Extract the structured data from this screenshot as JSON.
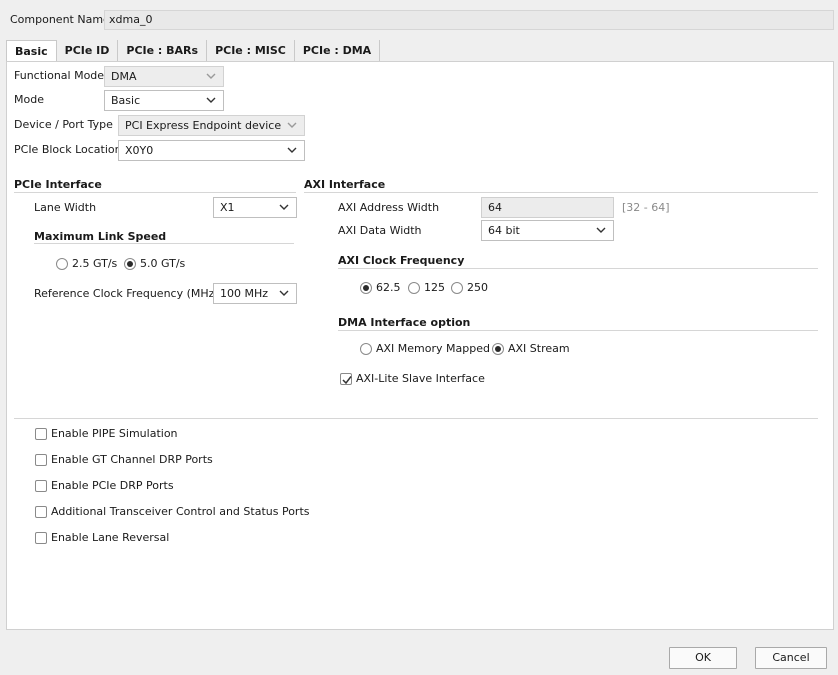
{
  "component": {
    "label": "Component Name",
    "value": "xdma_0"
  },
  "tabs": [
    "Basic",
    "PCIe ID",
    "PCIe : BARs",
    "PCIe : MISC",
    "PCIe : DMA"
  ],
  "basic": {
    "functional_mode": {
      "label": "Functional Mode",
      "value": "DMA"
    },
    "mode": {
      "label": "Mode",
      "value": "Basic"
    },
    "device_port_type": {
      "label": "Device / Port Type",
      "value": "PCI Express Endpoint device"
    },
    "block_location": {
      "label": "PCIe Block Location",
      "value": "X0Y0"
    }
  },
  "pcie_interface": {
    "title": "PCIe Interface",
    "lane_width": {
      "label": "Lane Width",
      "value": "X1"
    },
    "max_link_speed": {
      "title": "Maximum Link Speed",
      "options": [
        "2.5 GT/s",
        "5.0 GT/s"
      ],
      "selected": "5.0 GT/s"
    },
    "ref_clock": {
      "label": "Reference Clock Frequency (MHz)",
      "value": "100 MHz"
    }
  },
  "axi_interface": {
    "title": "AXI Interface",
    "address_width": {
      "label": "AXI Address Width",
      "value": "64",
      "range": "[32 - 64]"
    },
    "data_width": {
      "label": "AXI Data Width",
      "value": "64 bit"
    },
    "clock_frequency": {
      "title": "AXI Clock Frequency",
      "options": [
        "62.5",
        "125",
        "250"
      ],
      "selected": "62.5"
    },
    "dma_option": {
      "title": "DMA Interface option",
      "options": [
        "AXI Memory Mapped",
        "AXI Stream"
      ],
      "selected": "AXI Stream"
    },
    "axi_lite": {
      "label": "AXI-Lite Slave Interface",
      "checked": true
    }
  },
  "options": [
    {
      "label": "Enable PIPE Simulation",
      "checked": false
    },
    {
      "label": "Enable GT Channel DRP Ports",
      "checked": false
    },
    {
      "label": "Enable PCIe DRP Ports",
      "checked": false
    },
    {
      "label": "Additional Transceiver Control and Status Ports",
      "checked": false
    },
    {
      "label": "Enable Lane Reversal",
      "checked": false
    }
  ],
  "buttons": {
    "ok": "OK",
    "cancel": "Cancel"
  },
  "icons": {
    "dropdown": "chevron-down-icon",
    "checkmark": "checkmark-icon"
  }
}
